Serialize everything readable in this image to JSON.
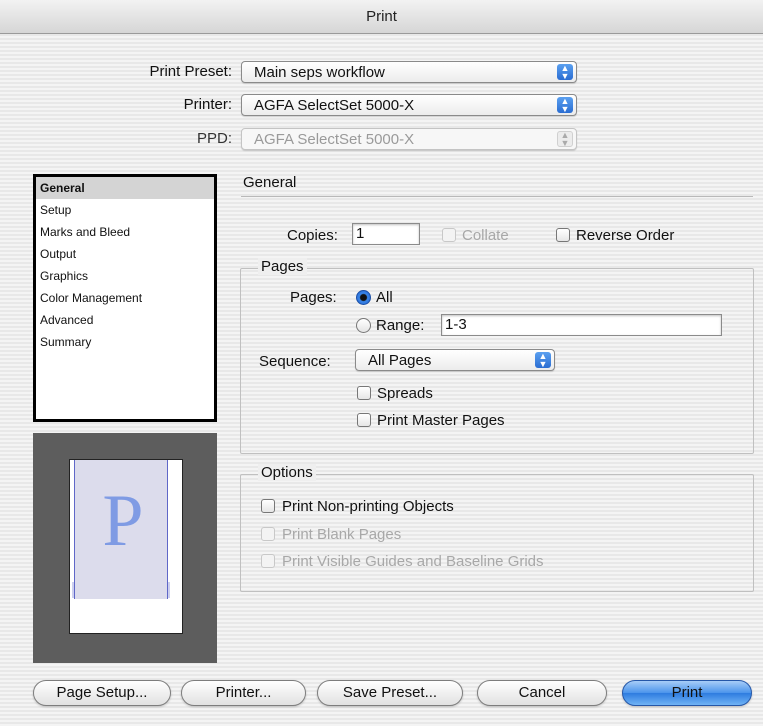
{
  "window": {
    "title": "Print"
  },
  "top": {
    "preset_label": "Print Preset:",
    "preset_value": "Main seps workflow",
    "printer_label": "Printer:",
    "printer_value": "AGFA SelectSet 5000-X",
    "ppd_label": "PPD:",
    "ppd_value": "AGFA SelectSet 5000-X"
  },
  "sidebar": {
    "items": [
      {
        "label": "General",
        "selected": true
      },
      {
        "label": "Setup"
      },
      {
        "label": "Marks and Bleed"
      },
      {
        "label": "Output"
      },
      {
        "label": "Graphics"
      },
      {
        "label": "Color Management"
      },
      {
        "label": "Advanced"
      },
      {
        "label": "Summary"
      }
    ]
  },
  "preview": {
    "letter": "P"
  },
  "general": {
    "title": "General",
    "copies_label": "Copies:",
    "copies_value": "1",
    "collate_label": "Collate",
    "reverse_label": "Reverse Order"
  },
  "pages": {
    "title": "Pages",
    "pages_label": "Pages:",
    "all_label": "All",
    "range_label": "Range:",
    "range_value": "1-3",
    "sequence_label": "Sequence:",
    "sequence_value": "All Pages",
    "spreads_label": "Spreads",
    "master_label": "Print Master Pages"
  },
  "options": {
    "title": "Options",
    "nonprinting_label": "Print Non-printing Objects",
    "blank_label": "Print Blank Pages",
    "guides_label": "Print Visible Guides and Baseline Grids"
  },
  "buttons": {
    "page_setup": "Page Setup...",
    "printer": "Printer...",
    "save_preset": "Save Preset...",
    "cancel": "Cancel",
    "print": "Print"
  },
  "colors": {
    "accent": "#3a86ea",
    "preview_bg": "#5d5d5d",
    "preview_letter": "#7f9be4"
  }
}
